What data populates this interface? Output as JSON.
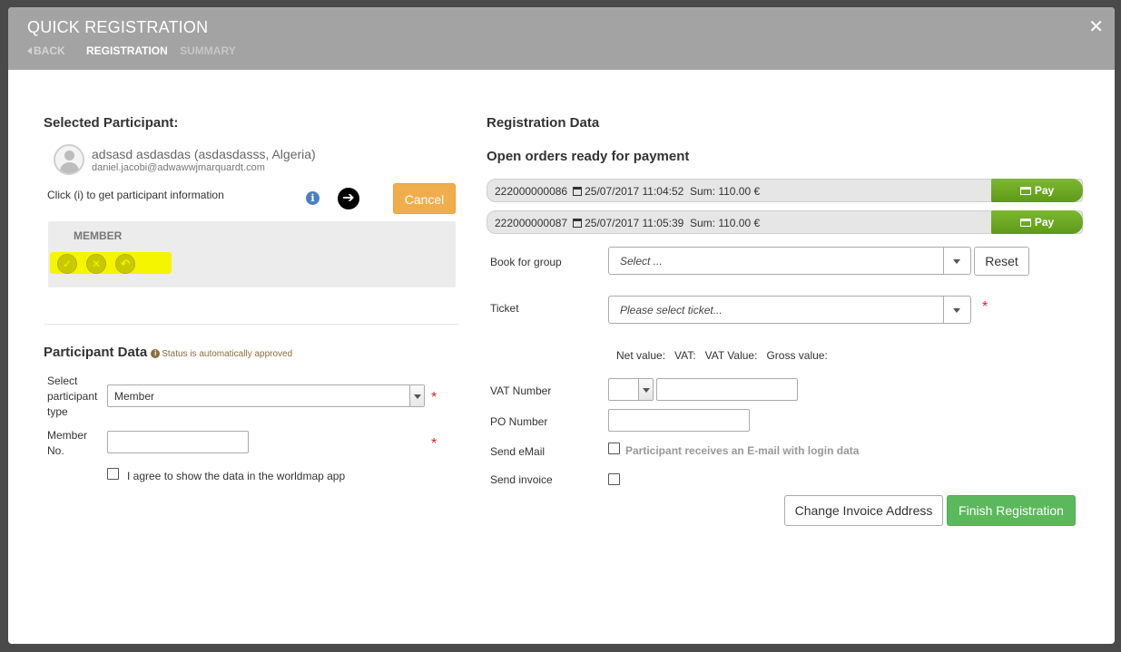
{
  "header": {
    "title": "QUICK REGISTRATION",
    "close_glyph": "✕",
    "steps": {
      "back": "BACK",
      "registration": "REGISTRATION",
      "summary": "SUMMARY"
    }
  },
  "participant": {
    "heading": "Selected Participant:",
    "name": "adsasd asdasdas (asdasdasss, Algeria)",
    "email": "daniel.jacobi@adwawwjmarquardt.com",
    "hint": "Click (i) to get participant information",
    "cancel_label": "Cancel",
    "member_box": {
      "label": "MEMBER",
      "highlight_color": "#f5f500"
    }
  },
  "participant_data": {
    "heading": "Participant Data",
    "status_text": "Status is automatically approved",
    "type_label": "Select participant type",
    "type_value": "Member",
    "member_no_label": "Member No.",
    "member_no_value": "",
    "worldmap_label": "I agree to show the data in the worldmap app"
  },
  "registration": {
    "heading": "Registration Data",
    "orders_heading": "Open orders ready for payment",
    "orders": [
      {
        "id": "222000000086",
        "datetime": "25/07/2017 11:04:52",
        "sum": "Sum: 110.00 €",
        "pay_label": "Pay"
      },
      {
        "id": "222000000087",
        "datetime": "25/07/2017 11:05:39",
        "sum": "Sum: 110.00 €",
        "pay_label": "Pay"
      }
    ],
    "book_for_group_label": "Book for group",
    "book_for_group_placeholder": "Select ...",
    "reset_label": "Reset",
    "ticket_label": "Ticket",
    "ticket_placeholder": "Please select ticket...",
    "values": {
      "net": "Net value:",
      "vat": "VAT:",
      "vat_value": "VAT Value:",
      "gross": "Gross value:"
    },
    "vat_number_label": "VAT Number",
    "vat_number_value": "",
    "po_number_label": "PO Number",
    "po_number_value": "",
    "send_email_label": "Send eMail",
    "send_email_desc": "Participant receives an E-mail with login data",
    "send_invoice_label": "Send invoice",
    "change_invoice_label": "Change Invoice Address",
    "finish_label": "Finish Registration"
  },
  "colors": {
    "header_bg": "#a3a3a3",
    "cancel": "#f0ad4e",
    "pay": "#6aa823",
    "finish": "#5cb85c",
    "required": "#e02020"
  },
  "required_mark": "*"
}
